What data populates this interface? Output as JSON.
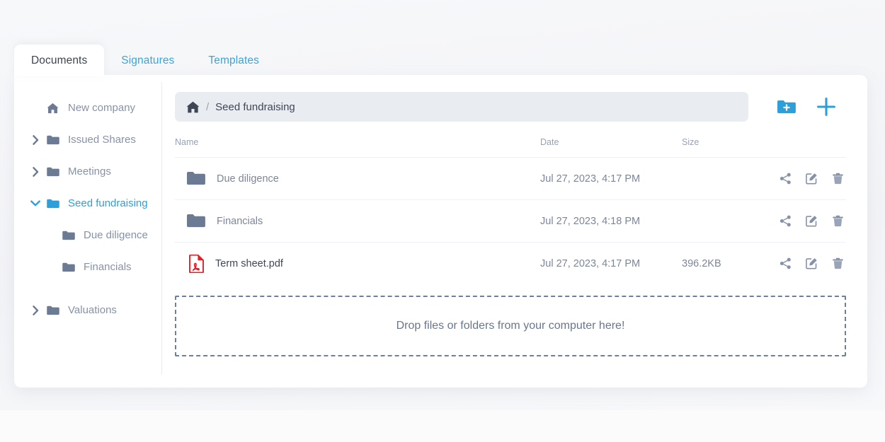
{
  "tabs": [
    {
      "label": "Documents",
      "active": true
    },
    {
      "label": "Signatures",
      "active": false
    },
    {
      "label": "Templates",
      "active": false
    }
  ],
  "sidebar": {
    "items": [
      {
        "label": "New company",
        "icon": "home-icon",
        "level": "root",
        "chevron": "none",
        "active": false
      },
      {
        "label": "Issued Shares",
        "icon": "folder-icon",
        "level": "top",
        "chevron": "right",
        "active": false
      },
      {
        "label": "Meetings",
        "icon": "folder-icon",
        "level": "top",
        "chevron": "right",
        "active": false
      },
      {
        "label": "Seed fundraising",
        "icon": "folder-icon",
        "level": "top",
        "chevron": "down",
        "active": true
      },
      {
        "label": "Due diligence",
        "icon": "folder-icon",
        "level": "child",
        "chevron": "none",
        "active": false
      },
      {
        "label": "Financials",
        "icon": "folder-icon",
        "level": "child",
        "chevron": "none",
        "active": false
      },
      {
        "label": "Valuations",
        "icon": "folder-icon",
        "level": "top",
        "chevron": "right",
        "active": false
      }
    ]
  },
  "breadcrumb": {
    "home_icon": "home-icon",
    "separator": "/",
    "current": "Seed fundraising"
  },
  "toolbar": {
    "new_folder_icon": "folder-plus-icon",
    "add_icon": "plus-icon"
  },
  "table": {
    "headers": {
      "name": "Name",
      "date": "Date",
      "size": "Size"
    },
    "rows": [
      {
        "name": "Due diligence",
        "date": "Jul 27, 2023, 4:17 PM",
        "size": "",
        "icon": "folder-icon",
        "type": "folder"
      },
      {
        "name": "Financials",
        "date": "Jul 27, 2023, 4:18 PM",
        "size": "",
        "icon": "folder-icon",
        "type": "folder"
      },
      {
        "name": "Term sheet.pdf",
        "date": "Jul 27, 2023, 4:17 PM",
        "size": "396.2KB",
        "icon": "pdf-icon",
        "type": "file"
      }
    ],
    "actions": [
      {
        "icon": "share-icon",
        "label": "Share"
      },
      {
        "icon": "edit-icon",
        "label": "Edit"
      },
      {
        "icon": "delete-icon",
        "label": "Delete"
      }
    ]
  },
  "dropzone": {
    "text": "Drop files or folders from your computer here!"
  },
  "colors": {
    "accent": "#2e9fd8",
    "tab_link": "#39a5dc",
    "folder": "#6d7a94",
    "pdf": "#ec1c24",
    "muted_text": "#7c8699",
    "dark_text": "#3f4757",
    "breadcrumb_bg": "#e9ecf1"
  }
}
